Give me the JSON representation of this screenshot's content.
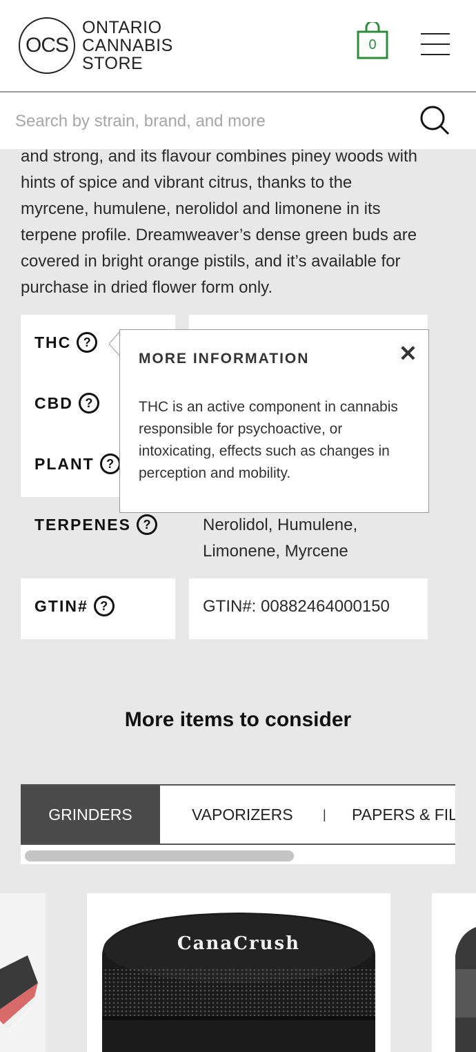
{
  "header": {
    "logo_mark": "OCS",
    "logo_line1": "ONTARIO",
    "logo_line2": "CANNABIS",
    "logo_line3": "STORE",
    "cart_count": "0",
    "cart_icon": "shopping-bag-icon",
    "menu_icon": "hamburger-menu-icon",
    "accent_color": "#2e8b3c"
  },
  "search": {
    "placeholder": "Search by strain, brand, and more",
    "icon": "search-icon"
  },
  "description": {
    "line1": "and strong, and its flavour combines piney woods with",
    "line2": "hints of spice and vibrant citrus, thanks to the",
    "line3": "myrcene, humulene, nerolidol and limonene in its",
    "line4": "terpene profile. Dreamweaver’s dense green buds are",
    "line5": "covered in bright orange pistils, and it’s available for",
    "line6": "purchase in dried flower form only."
  },
  "attributes": {
    "thc": {
      "label": "THC"
    },
    "cbd": {
      "label": "CBD"
    },
    "plant": {
      "label": "PLANT"
    },
    "terpenes": {
      "label": "TERPENES",
      "value_line1": "Nerolidol, Humulene,",
      "value_line2": "Limonene, Myrcene"
    },
    "gtin": {
      "label": "GTIN#",
      "value": "GTIN#: 00882464000150"
    },
    "help_glyph": "?"
  },
  "popover": {
    "title": "MORE INFORMATION",
    "close": "✕",
    "body": "THC is an active component in cannabis responsible for psychoactive, or intoxicating, effects such as changes in perception and mobility."
  },
  "more_items": {
    "title": "More items to consider",
    "tabs": [
      {
        "label": "GRINDERS",
        "active": true
      },
      {
        "label": "VAPORIZERS",
        "active": false
      },
      {
        "label": "PAPERS & FIL",
        "active": false
      }
    ],
    "tab_separator": "|",
    "product_brand": "CanaCrush"
  }
}
